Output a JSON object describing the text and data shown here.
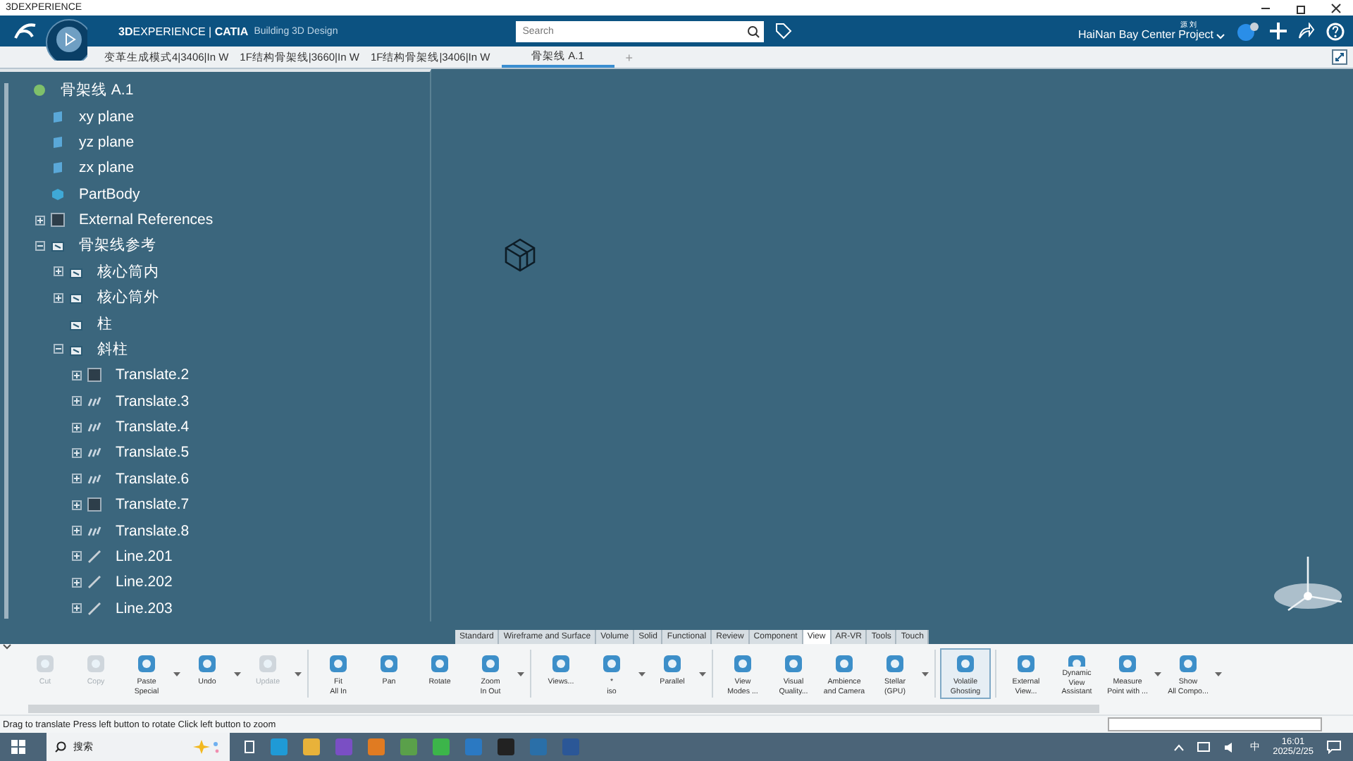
{
  "window": {
    "title": "3DEXPERIENCE"
  },
  "header": {
    "brand": "**3D**EXPERIENCE | **CATIA**",
    "app": "Building 3D Design",
    "search": {
      "placeholder": "Search"
    },
    "user": "源 刘",
    "project": "HaiNan Bay Center Project"
  },
  "doc_tabs": [
    {
      "label": "变革生成模式4|3406|In W",
      "selected": false
    },
    {
      "label": "1F结构骨架线|3660|In W",
      "selected": false
    },
    {
      "label": "1F结构骨架线|3406|In W",
      "selected": false
    },
    {
      "label": "骨架线 A.1",
      "selected": true
    }
  ],
  "new_tab": "+",
  "tree": {
    "label": "骨架线 A.1",
    "kind": "part",
    "children": [
      {
        "label": "xy plane",
        "kind": "plane"
      },
      {
        "label": "yz plane",
        "kind": "plane"
      },
      {
        "label": "zx plane",
        "kind": "plane"
      },
      {
        "label": "PartBody",
        "kind": "body"
      },
      {
        "label": "External References",
        "kind": "reference",
        "expanded": false
      },
      {
        "label": "骨架线参考",
        "kind": "geoset",
        "expanded": true,
        "children": [
          {
            "label": "核心筒内",
            "kind": "geoset",
            "expanded": false
          },
          {
            "label": "核心筒外",
            "kind": "geoset",
            "expanded": false
          },
          {
            "label": "柱",
            "kind": "geoset"
          },
          {
            "label": "斜柱",
            "kind": "geoset",
            "expanded": true,
            "children": [
              {
                "label": "Translate.2",
                "kind": "reference",
                "expanded": false
              },
              {
                "label": "Translate.3",
                "kind": "translate",
                "expanded": false
              },
              {
                "label": "Translate.4",
                "kind": "translate",
                "expanded": false
              },
              {
                "label": "Translate.5",
                "kind": "translate",
                "expanded": false
              },
              {
                "label": "Translate.6",
                "kind": "translate",
                "expanded": false
              },
              {
                "label": "Translate.7",
                "kind": "reference",
                "expanded": false
              },
              {
                "label": "Translate.8",
                "kind": "translate",
                "expanded": false
              },
              {
                "label": "Line.201",
                "kind": "line",
                "expanded": false
              },
              {
                "label": "Line.202",
                "kind": "line",
                "expanded": false
              },
              {
                "label": "Line.203",
                "kind": "line",
                "expanded": false
              }
            ]
          }
        ]
      }
    ]
  },
  "toolbar_tabs": [
    {
      "label": "Standard",
      "selected": false
    },
    {
      "label": "Wireframe and Surface",
      "selected": false
    },
    {
      "label": "Volume",
      "selected": false
    },
    {
      "label": "Solid",
      "selected": false
    },
    {
      "label": "Functional",
      "selected": false
    },
    {
      "label": "Review",
      "selected": false
    },
    {
      "label": "Component",
      "selected": false
    },
    {
      "label": "View",
      "selected": true
    },
    {
      "label": "AR-VR",
      "selected": false
    },
    {
      "label": "Tools",
      "selected": false
    },
    {
      "label": "Touch",
      "selected": false
    }
  ],
  "toolbar_groups": [
    [
      {
        "label": "Cut",
        "disabled": true,
        "dropdown": false,
        "selected": false
      },
      {
        "label": "Copy",
        "disabled": true,
        "dropdown": false,
        "selected": false
      },
      {
        "label": "Paste\nSpecial",
        "disabled": false,
        "dropdown": true,
        "selected": false
      },
      {
        "label": "Undo",
        "disabled": false,
        "dropdown": true,
        "selected": false
      },
      {
        "label": "Update",
        "disabled": true,
        "dropdown": true,
        "selected": false
      }
    ],
    [
      {
        "label": "Fit\nAll In",
        "disabled": false,
        "dropdown": false,
        "selected": false
      },
      {
        "label": "Pan",
        "disabled": false,
        "dropdown": false,
        "selected": false
      },
      {
        "label": "Rotate",
        "disabled": false,
        "dropdown": false,
        "selected": false
      },
      {
        "label": "Zoom\nIn Out",
        "disabled": false,
        "dropdown": true,
        "selected": false
      }
    ],
    [
      {
        "label": "Views...",
        "disabled": false,
        "dropdown": false,
        "selected": false
      },
      {
        "label": "*\niso",
        "disabled": false,
        "dropdown": true,
        "selected": false
      },
      {
        "label": "Parallel",
        "disabled": false,
        "dropdown": true,
        "selected": false
      }
    ],
    [
      {
        "label": "View\nModes ...",
        "disabled": false,
        "dropdown": false,
        "selected": false
      },
      {
        "label": "Visual\nQuality...",
        "disabled": false,
        "dropdown": false,
        "selected": false
      },
      {
        "label": "Ambience\nand Camera",
        "disabled": false,
        "dropdown": false,
        "selected": false
      },
      {
        "label": "Stellar\n(GPU)",
        "disabled": false,
        "dropdown": true,
        "selected": false
      }
    ],
    [
      {
        "label": "Volatile\nGhosting",
        "disabled": false,
        "dropdown": false,
        "selected": true
      }
    ],
    [
      {
        "label": "External\nView...",
        "disabled": false,
        "dropdown": false,
        "selected": false
      },
      {
        "label": "Dynamic\nView Assistant",
        "disabled": false,
        "dropdown": false,
        "selected": false
      },
      {
        "label": "Measure\nPoint with ...",
        "disabled": false,
        "dropdown": true,
        "selected": false
      },
      {
        "label": "Show\nAll Compo...",
        "disabled": false,
        "dropdown": true,
        "selected": false
      }
    ]
  ],
  "status_bar": {
    "message": "Drag to translate  Press left button to rotate  Click left button to zoom"
  },
  "taskbar": {
    "search": "搜索",
    "ime": "中",
    "time": "16:01",
    "date": "2025/2/25"
  }
}
